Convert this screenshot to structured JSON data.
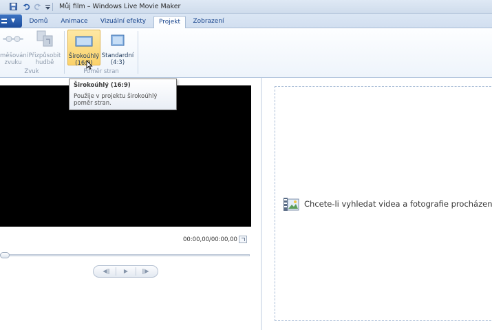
{
  "window": {
    "title": "Můj film – Windows Live Movie Maker"
  },
  "tabs": [
    {
      "label": "Domů"
    },
    {
      "label": "Animace"
    },
    {
      "label": "Vizuální efekty"
    },
    {
      "label": "Projekt"
    },
    {
      "label": "Zobrazení"
    }
  ],
  "ribbon": {
    "groups": [
      {
        "label": "Zvuk",
        "buttons": [
          {
            "label_1": "měšování",
            "label_2": "zvuku"
          },
          {
            "label_1": "Přizpůsobit",
            "label_2": "hudbě"
          }
        ]
      },
      {
        "label": "Poměr stran",
        "buttons": [
          {
            "label_1": "Širokoúhlý",
            "label_2": "(16:9)"
          },
          {
            "label_1": "Standardní",
            "label_2": "(4:3)"
          }
        ]
      }
    ]
  },
  "tooltip": {
    "title": "Širokoúhlý (16:9)",
    "body": "Použije v projektu širokoúhlý poměr stran."
  },
  "preview": {
    "timecode": "00:00,00/00:00,00"
  },
  "storyboard": {
    "prompt": "Chcete-li vyhledat videa a fotografie procházením"
  },
  "colors": {
    "accent": "#1d4c9c",
    "pressed": "#fbd26a"
  }
}
